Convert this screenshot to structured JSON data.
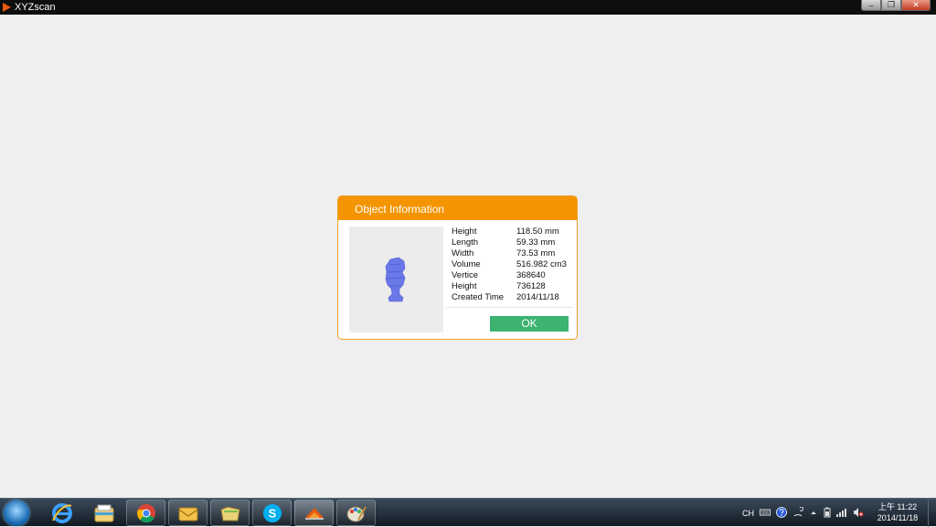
{
  "window": {
    "title": "XYZscan",
    "minimize": "–",
    "maximize": "❐",
    "close": "✕"
  },
  "dialog": {
    "title": "Object Information",
    "rows": [
      {
        "label": "Height",
        "value": "118.50 mm"
      },
      {
        "label": "Length",
        "value": "59.33 mm"
      },
      {
        "label": "Width",
        "value": "73.53 mm"
      },
      {
        "label": "Volume",
        "value": "516.982 cm3"
      },
      {
        "label": "Vertice",
        "value": "368640"
      },
      {
        "label": "Height",
        "value": "736128"
      },
      {
        "label": "Created Time",
        "value": "2014/11/18"
      }
    ],
    "ok_label": "OK"
  },
  "taskbar": {
    "apps": [
      "internet-explorer-icon",
      "file-explorer-icon",
      "chrome-icon",
      "mail-icon",
      "folder-icon",
      "skype-icon",
      "xyzscan-icon",
      "paint-icon"
    ],
    "skype_glyph": "S",
    "lang": "CH",
    "clock": {
      "time": "上午 11:22",
      "date": "2014/11/18"
    }
  },
  "colors": {
    "accent": "#f39400",
    "ok": "#3cb371",
    "model": "#6a78e8"
  }
}
